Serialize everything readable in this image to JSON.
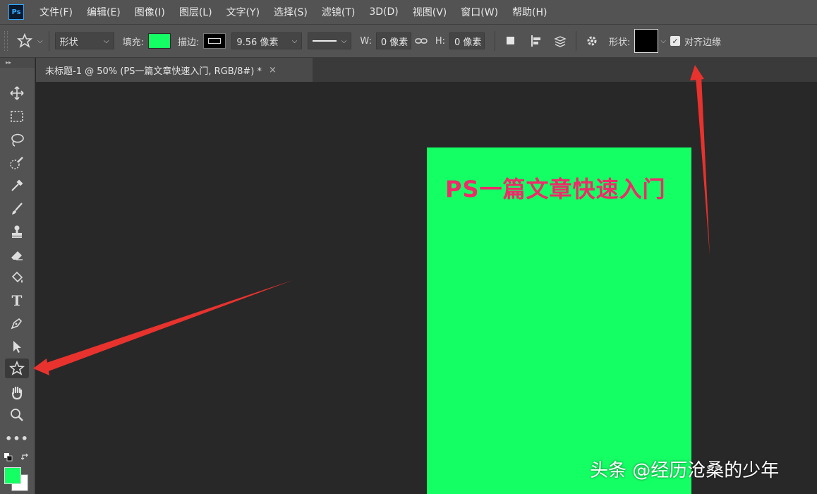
{
  "app": {
    "logo": "Ps"
  },
  "menu": [
    "文件(F)",
    "编辑(E)",
    "图像(I)",
    "图层(L)",
    "文字(Y)",
    "选择(S)",
    "滤镜(T)",
    "3D(D)",
    "视图(V)",
    "窗口(W)",
    "帮助(H)"
  ],
  "options": {
    "mode_value": "形状",
    "fill_label": "填充:",
    "fill_color": "#14ff64",
    "stroke_label": "描边:",
    "stroke_width": "9.56 像素",
    "w_label": "W:",
    "w_value": "0 像素",
    "h_label": "H:",
    "h_value": "0 像素",
    "shape_label": "形状:",
    "shape_color": "#000000",
    "align_edges_label": "对齐边缘",
    "align_edges_checked": true
  },
  "document": {
    "tab_title": "未标题-1 @ 50% (PS一篇文章快速入门, RGB/8#) *",
    "close": "×",
    "canvas_color": "#14ff64",
    "heading": "PS一篇文章快速入门",
    "heading_color": "#ee2a6a"
  },
  "tools": [
    "move-tool",
    "marquee-tool",
    "lasso-tool",
    "quick-selection-tool",
    "eyedropper-tool",
    "brush-tool",
    "stamp-tool",
    "eraser-tool",
    "paint-bucket-tool",
    "type-tool",
    "pen-tool",
    "path-selection-tool",
    "custom-shape-tool",
    "hand-tool",
    "zoom-tool",
    "more-tools"
  ],
  "active_tool": "custom-shape-tool",
  "colors": {
    "foreground": "#14ff64",
    "background": "#ffffff"
  },
  "watermark": "头条 @经历沧桑的少年",
  "annotation_color": "#e8322e"
}
